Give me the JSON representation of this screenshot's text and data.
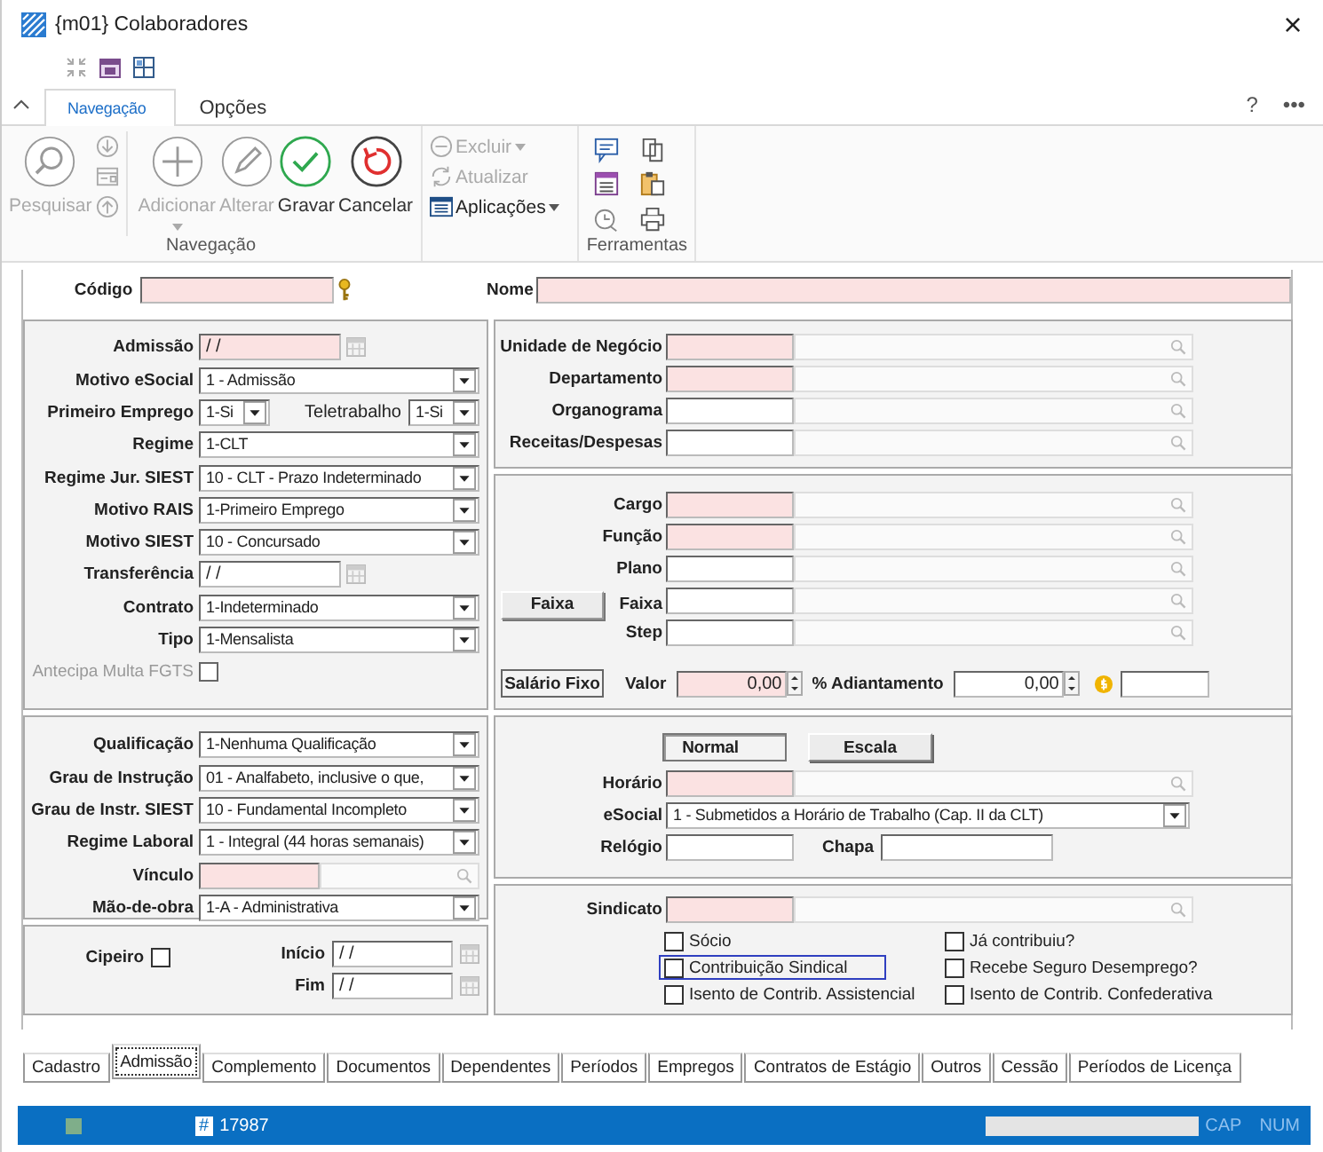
{
  "window": {
    "title": "{m01} Colaboradores",
    "close": "×"
  },
  "ribbon": {
    "tabs": [
      {
        "label": "Navegação",
        "selected": true
      },
      {
        "label": "Opções",
        "selected": false
      }
    ],
    "help": "?",
    "more": "•••",
    "nav_buttons": [
      {
        "kind": "search",
        "label": "Pesquisar",
        "disabled": true,
        "dropdown": false
      },
      {
        "kind": "add",
        "label": "Adicionar",
        "disabled": true,
        "dropdown": true
      },
      {
        "kind": "edit",
        "label": "Alterar",
        "disabled": true,
        "dropdown": false
      },
      {
        "kind": "save",
        "label": "Gravar",
        "disabled": false,
        "dropdown": false
      },
      {
        "kind": "cancel",
        "label": "Cancelar",
        "disabled": false,
        "dropdown": false
      }
    ],
    "nav_label": "Navegação",
    "actions": [
      {
        "kind": "delete",
        "label": "Excluir",
        "disabled": true,
        "dropdown": true
      },
      {
        "kind": "refresh",
        "label": "Atualizar",
        "disabled": true,
        "dropdown": false
      },
      {
        "kind": "apps",
        "label": "Aplicações",
        "disabled": false,
        "dropdown": true
      }
    ],
    "tools_label": "Ferramentas"
  },
  "header": {
    "codigo": {
      "label": "Código",
      "required": true
    },
    "nome": {
      "label": "Nome",
      "required": true
    }
  },
  "admission_panel": [
    {
      "kind": "date",
      "label": "Admissão",
      "value": "/ /",
      "required": true
    },
    {
      "kind": "select",
      "label": "Motivo eSocial",
      "value": "1 - Admissão"
    },
    {
      "kind": "pair",
      "label": "Primeiro Emprego",
      "value": "1-Si",
      "label2": "Teletrabalho",
      "value2": "1-Si"
    },
    {
      "kind": "select",
      "label": "Regime",
      "value": "1-CLT"
    },
    {
      "kind": "select",
      "label": "Regime Jur. SIEST",
      "value": "10 - CLT - Prazo Indeterminado"
    },
    {
      "kind": "select",
      "label": "Motivo RAIS",
      "value": "1-Primeiro Emprego"
    },
    {
      "kind": "select",
      "label": "Motivo SIEST",
      "value": "10 - Concursado"
    },
    {
      "kind": "date",
      "label": "Transferência",
      "value": "/ /",
      "required": false
    },
    {
      "kind": "select",
      "label": "Contrato",
      "value": "1-Indeterminado"
    },
    {
      "kind": "select",
      "label": "Tipo",
      "value": "1-Mensalista"
    },
    {
      "kind": "checkbox",
      "label": "Antecipa Multa FGTS",
      "checked": false,
      "disabled": true
    }
  ],
  "qualification_panel": [
    {
      "kind": "select",
      "label": "Qualificação",
      "value": "1-Nenhuma Qualificação"
    },
    {
      "kind": "select",
      "label": "Grau de Instrução",
      "value": "01 - Analfabeto, inclusive o que,"
    },
    {
      "kind": "select",
      "label": "Grau de Instr. SIEST",
      "value": "10 - Fundamental Incompleto"
    },
    {
      "kind": "select",
      "label": "Regime Laboral",
      "value": "1 - Integral (44 horas semanais)"
    },
    {
      "kind": "lookup",
      "label": "Vínculo",
      "required": true
    },
    {
      "kind": "select",
      "label": "Mão-de-obra",
      "value": "1-A - Administrativa"
    }
  ],
  "cipa_panel": {
    "cipeiro": {
      "label": "Cipeiro",
      "checked": false
    },
    "dates": [
      {
        "label": "Início",
        "value": "/ /"
      },
      {
        "label": "Fim",
        "value": "/ /"
      }
    ]
  },
  "org_panel": [
    {
      "label": "Unidade de Negócio",
      "required": true
    },
    {
      "label": "Departamento",
      "required": true
    },
    {
      "label": "Organograma",
      "required": false
    },
    {
      "label": "Receitas/Despesas",
      "required": false
    }
  ],
  "position_panel": {
    "lookups": [
      {
        "label": "Cargo",
        "required": true
      },
      {
        "label": "Função",
        "required": true
      },
      {
        "label": "Plano",
        "required": false
      }
    ],
    "faixa_button": {
      "label": "Faixa",
      "pressed": false
    },
    "faixa_lookups": [
      {
        "label": "Faixa",
        "required": false
      },
      {
        "label": "Step",
        "required": false
      }
    ],
    "salary_button": {
      "label": "Salário Fixo",
      "pressed": true
    },
    "valor": {
      "label": "Valor",
      "value": "0,00",
      "required": true
    },
    "adiantamento": {
      "label": "% Adiantamento",
      "value": "0,00",
      "required": false
    }
  },
  "schedule_panel": {
    "modes": [
      {
        "label": "Normal",
        "selected": true
      },
      {
        "label": "Escala",
        "selected": false
      }
    ],
    "horario": {
      "label": "Horário",
      "required": true
    },
    "esocial": {
      "label": "eSocial",
      "value": "1 - Submetidos a Horário de Trabalho (Cap. II da CLT)"
    },
    "relogio": {
      "label": "Relógio"
    },
    "chapa": {
      "label": "Chapa"
    }
  },
  "union_panel": {
    "sindicato": {
      "label": "Sindicato",
      "required": true
    },
    "options": [
      {
        "label": "Sócio",
        "checked": false,
        "focused": false
      },
      {
        "label": "Já contribuiu?",
        "checked": false,
        "focused": false
      },
      {
        "label": "Contribuição Sindical",
        "checked": false,
        "focused": true
      },
      {
        "label": "Recebe Seguro Desemprego?",
        "checked": false,
        "focused": false
      },
      {
        "label": "Isento de Contrib. Assistencial",
        "checked": false,
        "focused": false
      },
      {
        "label": "Isento de Contrib. Confederativa",
        "checked": false,
        "focused": false
      }
    ]
  },
  "tabs": [
    {
      "label": "Cadastro",
      "selected": false
    },
    {
      "label": "Admissão",
      "selected": true
    },
    {
      "label": "Complemento",
      "selected": false
    },
    {
      "label": "Documentos",
      "selected": false
    },
    {
      "label": "Dependentes",
      "selected": false
    },
    {
      "label": "Períodos",
      "selected": false
    },
    {
      "label": "Empregos",
      "selected": false
    },
    {
      "label": "Contratos de Estágio",
      "selected": false
    },
    {
      "label": "Outros",
      "selected": false
    },
    {
      "label": "Cessão",
      "selected": false
    },
    {
      "label": "Períodos de Licença",
      "selected": false
    }
  ],
  "status_bar": {
    "symbol": "#",
    "record": "17987",
    "caps": "CAP",
    "num": "NUM"
  }
}
